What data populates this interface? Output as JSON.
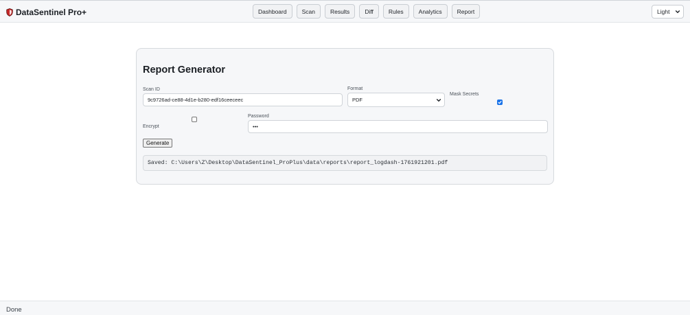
{
  "app": {
    "title": "DataSentinel Pro+",
    "icon": "shield-icon",
    "accent": "#c62828"
  },
  "nav": {
    "items": [
      {
        "label": "Dashboard"
      },
      {
        "label": "Scan"
      },
      {
        "label": "Results"
      },
      {
        "label": "Diff"
      },
      {
        "label": "Rules"
      },
      {
        "label": "Analytics"
      },
      {
        "label": "Report"
      }
    ]
  },
  "theme": {
    "value": "Light",
    "icon": "chevron-down-icon"
  },
  "report": {
    "title": "Report Generator",
    "scan_id_label": "Scan ID",
    "scan_id_value": "9c9726ad-ce88-4d1e-b280-edf16ceeceec",
    "format_label": "Format",
    "format_value": "PDF",
    "mask_secrets_label": "Mask Secrets",
    "mask_secrets_checked": true,
    "encrypt_label": "Encrypt",
    "encrypt_checked": false,
    "password_label": "Password",
    "password_value": "•••",
    "generate_label": "Generate",
    "output_text": "Saved: C:\\Users\\Z\\Desktop\\DataSentinel_ProPlus\\data\\reports\\report_logdash-1761921201.pdf",
    "checkbox_color": "#1a73e8"
  },
  "status": {
    "text": "Done"
  }
}
